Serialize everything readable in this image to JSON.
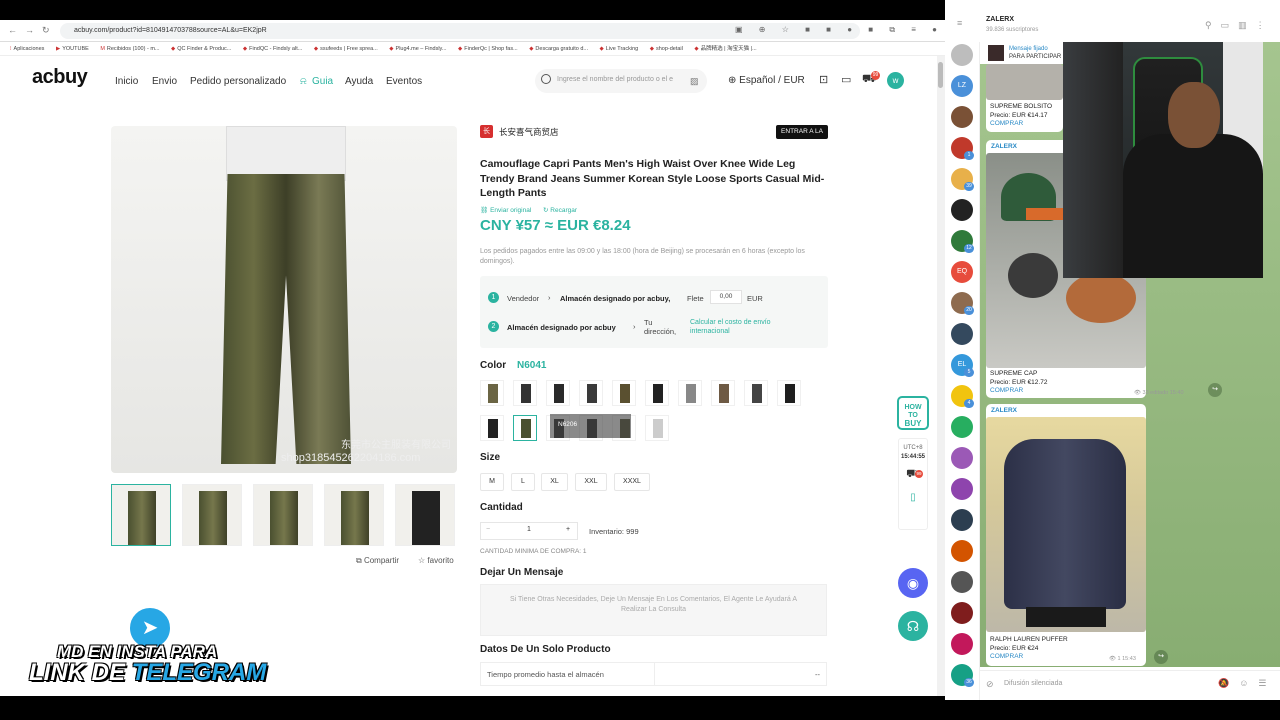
{
  "browser": {
    "url": "acbuy.com/product?id=8104914703788source=AL&u=EK2jpR",
    "bookmarks": [
      "Aplicaciones",
      "YOUTUBE",
      "Recibidos (100) - m...",
      "QC Finder & Produc...",
      "FindQC - Findsly alt...",
      "ssufeeds | Free sprea...",
      "Plug4.me – Findsly...",
      "FinderQc | Shop fas...",
      "Descarga gratuito d...",
      "Live Tracking",
      "shop-detail",
      "品牌精选 | 淘宝天猫 |..."
    ]
  },
  "header": {
    "logo": "acbuy",
    "nav": [
      "Inicio",
      "Envio",
      "Pedido personalizado",
      "Guia",
      "Ayuda",
      "Eventos"
    ],
    "search_placeholder": "Ingrese el nombre del producto o el e",
    "language": "Español / EUR",
    "cart_badge": "99",
    "avatar": "w"
  },
  "gallery": {
    "watermark1": "东莞市公主服装有限公司",
    "watermark2": "shop318545262204186.com",
    "share": "Compartir",
    "favorite": "favorito"
  },
  "product": {
    "shop_icon": "长",
    "shop_name": "长安喜气商贸店",
    "enter_btn": "ENTRAR A LA",
    "title": "Camouflage Capri Pants Men's High Waist Over Knee Wide Leg Trendy Brand Jeans Summer Korean Style Loose Sports Casual Mid-Length Pants",
    "link_original": "Enviar original",
    "link_reload": "Recargar",
    "price": "CNY ¥57  ≈  EUR €8.24",
    "note": "Los pedidos pagados entre las 09:00 y las 18:00 (hora de Beijing) se procesarán en 6 horas (excepto los domingos).",
    "ship": {
      "step1_num": "1",
      "step1_a": "Vendedor",
      "step1_b": "Almacén designado por acbuy,",
      "flete_label": "Flete",
      "flete_value": "0,00",
      "currency": "EUR",
      "step2_num": "2",
      "step2_a": "Almacén designado por acbuy",
      "step2_b": "Tu dirección,",
      "calc_link": "Calcular el costo de envío internacional"
    },
    "color_label": "Color",
    "color_value": "N6041",
    "tooltip": "N6206",
    "size_label": "Size",
    "sizes": [
      "M",
      "L",
      "XL",
      "XXL",
      "XXXL"
    ],
    "qty_label": "Cantidad",
    "qty_minus": "−",
    "qty_value": "1",
    "qty_plus": "+",
    "inventory": "Inventario: 999",
    "min_qty": "CANTIDAD MINIMA DE COMPRA: 1",
    "msg_label": "Dejar Un Mensaje",
    "msg_placeholder": "Si Tiene Otras Necesidades, Deje Un Mensaje En Los Comentarios, El Agente Le Ayudará A Realizar La Consulta",
    "data_label": "Datos De Un Solo Producto",
    "table_first": "Tiempo promedio hasta el almacén",
    "table_val": "--"
  },
  "side": {
    "robot_line1": "HOW TO",
    "robot_line2": "BUY",
    "tz": "UTC+8",
    "time": "15:44:55",
    "cart_badge": "99"
  },
  "promo": {
    "line1": "MD EN INSTA PARA",
    "line2a": "LINK DE ",
    "line2b": "TELEGRAM"
  },
  "telegram": {
    "channel": "ZALERX",
    "subscribers": "39.836 suscriptores",
    "pinned_title": "Mensaje fijado",
    "pinned_text": "PARA PARTICIPAR",
    "chats": [
      {
        "initials": "",
        "color": "#bdbdbd"
      },
      {
        "initials": "LZ",
        "color": "#4a90d9"
      },
      {
        "initials": "",
        "color": "#7a5136",
        "badge": ""
      },
      {
        "initials": "",
        "color": "#c0392b",
        "badge": "1"
      },
      {
        "initials": "",
        "color": "#e8b04a",
        "badge": "39"
      },
      {
        "initials": "",
        "color": "#222",
        "badge": ""
      },
      {
        "initials": "",
        "color": "#2f7a3a",
        "badge": "12"
      },
      {
        "initials": "EQ",
        "color": "#e74c3c",
        "badge": ""
      },
      {
        "initials": "",
        "color": "#8e6b4f",
        "badge": "20"
      },
      {
        "initials": "",
        "color": "#34495e",
        "badge": ""
      },
      {
        "initials": "EL",
        "color": "#3498db",
        "badge": "5"
      },
      {
        "initials": "",
        "color": "#f1c40f",
        "badge": "4"
      },
      {
        "initials": "",
        "color": "#27ae60",
        "badge": ""
      },
      {
        "initials": "",
        "color": "#9b59b6",
        "badge": ""
      },
      {
        "initials": "",
        "color": "#8e44ad",
        "badge": ""
      },
      {
        "initials": "",
        "color": "#2c3e50",
        "badge": ""
      },
      {
        "initials": "",
        "color": "#d35400",
        "badge": ""
      },
      {
        "initials": "",
        "color": "#555",
        "badge": ""
      },
      {
        "initials": "",
        "color": "#7f1d1d",
        "badge": ""
      },
      {
        "initials": "",
        "color": "#c2185b",
        "badge": ""
      },
      {
        "initials": "",
        "color": "#16a085",
        "badge": "36"
      }
    ],
    "msg1": {
      "name": "SUPREME BOLSITO",
      "price": "Precio: EUR €14.17",
      "buy": "COMPRAR"
    },
    "msg2": {
      "author": "ZALERX",
      "name": "SUPREME CAP",
      "price": "Precio: EUR €12.72",
      "buy": "COMPRAR",
      "views": "33",
      "edited": "editado 15:40"
    },
    "msg3": {
      "author": "ZALERX",
      "name": "RALPH LAUREN PUFFER",
      "price": "Precio: EUR €24",
      "buy": "COMPRAR",
      "views": "1",
      "time": "15:43"
    },
    "footer": "Difusión silenciada"
  }
}
